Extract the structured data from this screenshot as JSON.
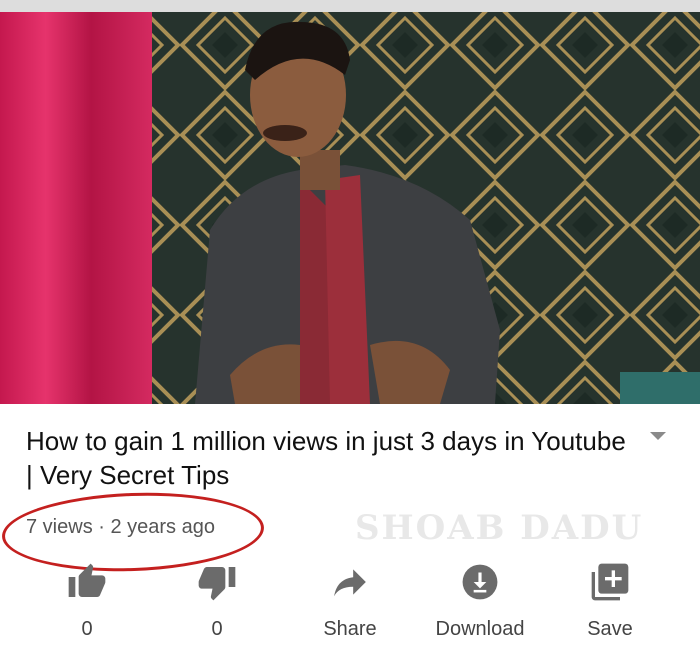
{
  "video": {
    "title": "How to gain 1 million views in just 3 days in Youtube | Very Secret Tips",
    "meta": "7 views · 2 years ago",
    "watermark": "SHOAB DADU"
  },
  "actions": [
    {
      "name": "like",
      "label": "0",
      "icon": "thumbs-up-icon"
    },
    {
      "name": "dislike",
      "label": "0",
      "icon": "thumbs-down-icon"
    },
    {
      "name": "share",
      "label": "Share",
      "icon": "share-arrow-icon"
    },
    {
      "name": "download",
      "label": "Download",
      "icon": "download-icon"
    },
    {
      "name": "save",
      "label": "Save",
      "icon": "playlist-add-icon"
    }
  ],
  "colors": {
    "annotation_circle": "#c4201f",
    "icon_gray": "#6b6b6b"
  }
}
